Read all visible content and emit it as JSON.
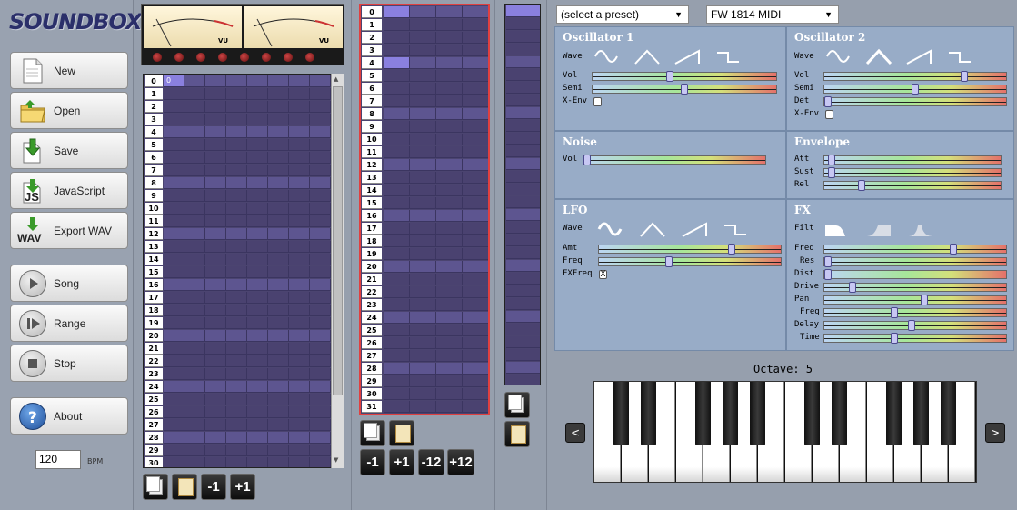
{
  "app": {
    "logo_text": "SOUNDBOX"
  },
  "menu": {
    "new": "New",
    "open": "Open",
    "save": "Save",
    "javascript": "JavaScript",
    "export_wav": "Export WAV",
    "song": "Song",
    "range": "Range",
    "stop": "Stop",
    "about": "About"
  },
  "icons": {
    "new": "new-document-icon",
    "open": "folder-open-icon",
    "save": "save-icon",
    "javascript": "javascript-icon",
    "export_wav": "wav-icon",
    "song": "play-icon",
    "range": "play-range-icon",
    "stop": "stop-icon",
    "about": "help-icon"
  },
  "icon_labels": {
    "js": "JS",
    "wav": "WAV"
  },
  "bpm": {
    "value": "120",
    "label": "BPM"
  },
  "vu_meter": {
    "left_label": "VU",
    "right_label": "VU"
  },
  "sequencer": {
    "rows": [
      "0",
      "1",
      "2",
      "3",
      "4",
      "5",
      "6",
      "7",
      "8",
      "9",
      "10",
      "11",
      "12",
      "13",
      "14",
      "15",
      "16",
      "17",
      "18",
      "19",
      "20",
      "21",
      "22",
      "23",
      "24",
      "25",
      "26",
      "27",
      "28",
      "29",
      "30"
    ],
    "first_cell": "0"
  },
  "pattern": {
    "rows": [
      "0",
      "1",
      "2",
      "3",
      "4",
      "5",
      "6",
      "7",
      "8",
      "9",
      "10",
      "11",
      "12",
      "13",
      "14",
      "15",
      "16",
      "17",
      "18",
      "19",
      "20",
      "21",
      "22",
      "23",
      "24",
      "25",
      "26",
      "27",
      "28",
      "29",
      "30",
      "31"
    ]
  },
  "fx_column": {
    "cell_text": ":"
  },
  "buttons": {
    "minus1": "-1",
    "plus1": "+1",
    "minus12": "-12",
    "plus12": "+12"
  },
  "preset": {
    "selected": "(select a preset)",
    "midi": "FW 1814 MIDI"
  },
  "instrument": {
    "osc1": {
      "title": "Oscillator 1",
      "wave_label": "Wave",
      "vol": "Vol",
      "semi": "Semi",
      "xenv": "X-Env",
      "vol_value": 0.42,
      "semi_value": 0.5
    },
    "osc2": {
      "title": "Oscillator 2",
      "wave_label": "Wave",
      "vol": "Vol",
      "semi": "Semi",
      "det": "Det",
      "xenv": "X-Env",
      "vol_value": 0.78,
      "semi_value": 0.5,
      "det_value": 0.0
    },
    "noise": {
      "title": "Noise",
      "vol": "Vol",
      "vol_value": 0.0
    },
    "envelope": {
      "title": "Envelope",
      "att": "Att",
      "sust": "Sust",
      "rel": "Rel",
      "att_value": 0.02,
      "sust_value": 0.02,
      "rel_value": 0.2
    },
    "lfo": {
      "title": "LFO",
      "wave_label": "Wave",
      "amt": "Amt",
      "freq": "Freq",
      "fxfreq": "FXFreq",
      "fxfreq_checked": "X",
      "amt_value": 0.74,
      "freq_value": 0.38
    },
    "fx": {
      "title": "FX",
      "filt_label": "Filt",
      "freq": "Freq",
      "res": "Res",
      "dist": "Dist",
      "drive": "Drive",
      "pan": "Pan",
      "delay_freq": "Freq",
      "delay": "Delay",
      "time": "Time",
      "freq_value": 0.72,
      "res_value": 0.0,
      "dist_value": 0.0,
      "drive_value": 0.14,
      "pan_value": 0.55,
      "delay_freq_value": 0.38,
      "delay_value": 0.48,
      "time_value": 0.38
    }
  },
  "keyboard": {
    "octave_label": "Octave: 5",
    "prev": "<",
    "next": ">"
  },
  "colors": {
    "grid_dark": "#4a4270",
    "grid_light": "#5d5590",
    "grid_selected": "#8a80df",
    "panel": "#98acc7",
    "pattern_border": "#e04040"
  }
}
